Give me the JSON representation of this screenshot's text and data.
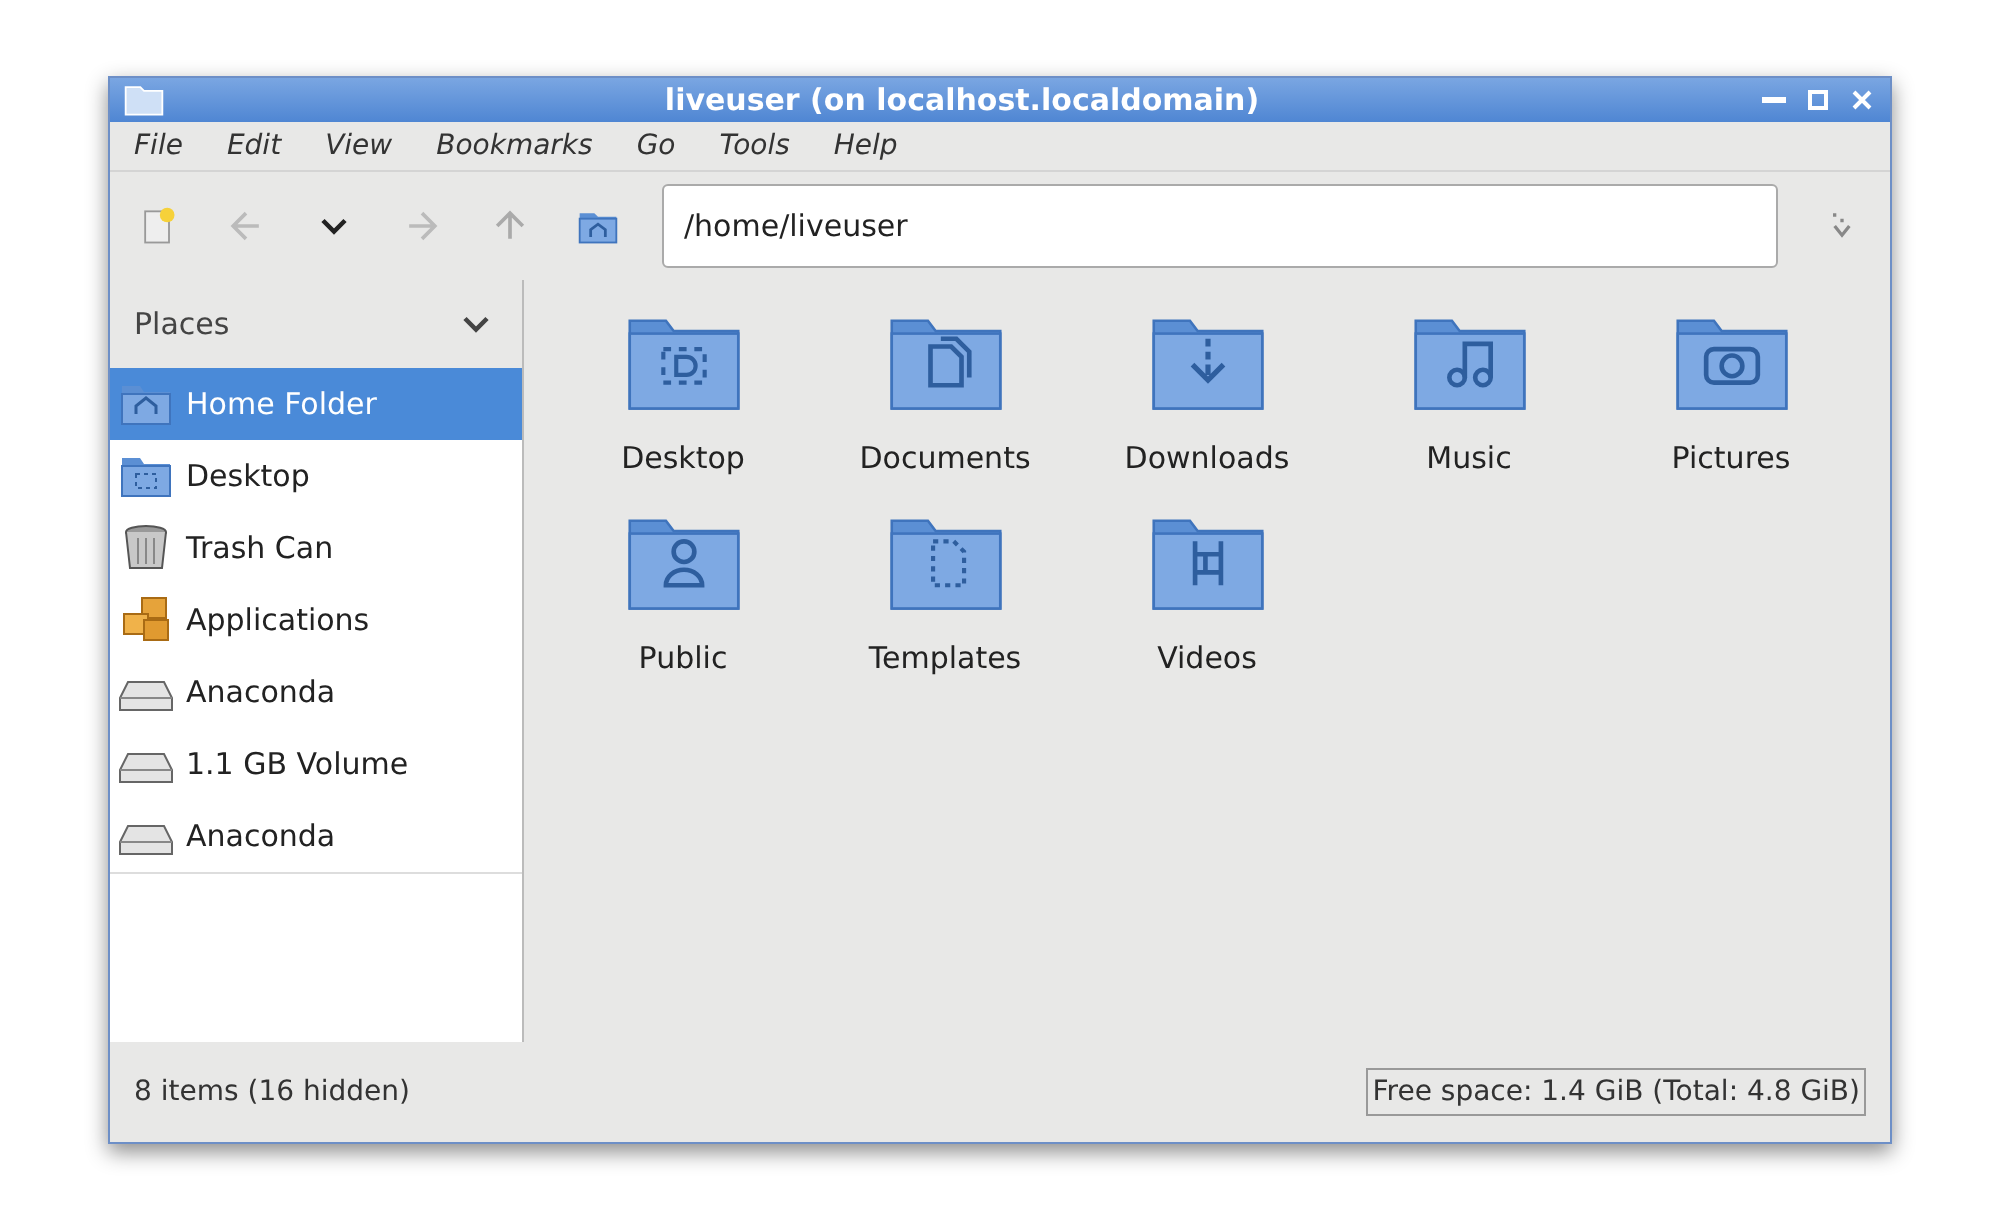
{
  "window": {
    "title": "liveuser (on localhost.localdomain)"
  },
  "menu": [
    "File",
    "Edit",
    "View",
    "Bookmarks",
    "Go",
    "Tools",
    "Help"
  ],
  "location": {
    "value": "/home/liveuser"
  },
  "sidebar": {
    "title": "Places",
    "items": [
      {
        "label": "Home Folder",
        "kind": "home",
        "selected": true
      },
      {
        "label": "Desktop",
        "kind": "desktop",
        "selected": false
      },
      {
        "label": "Trash Can",
        "kind": "trash",
        "selected": false
      },
      {
        "label": "Applications",
        "kind": "apps",
        "selected": false
      },
      {
        "label": "Anaconda",
        "kind": "drive",
        "selected": false
      },
      {
        "label": "1.1 GB Volume",
        "kind": "drive",
        "selected": false
      },
      {
        "label": "Anaconda",
        "kind": "drive",
        "selected": false
      }
    ]
  },
  "folders": [
    {
      "label": "Desktop",
      "kind": "desktop"
    },
    {
      "label": "Documents",
      "kind": "documents"
    },
    {
      "label": "Downloads",
      "kind": "downloads"
    },
    {
      "label": "Music",
      "kind": "music"
    },
    {
      "label": "Pictures",
      "kind": "pictures"
    },
    {
      "label": "Public",
      "kind": "public"
    },
    {
      "label": "Templates",
      "kind": "templates"
    },
    {
      "label": "Videos",
      "kind": "videos"
    }
  ],
  "status_bar": {
    "items": "8 items (16 hidden)",
    "free_space": "Free space: 1.4 GiB (Total: 4.8 GiB)"
  }
}
